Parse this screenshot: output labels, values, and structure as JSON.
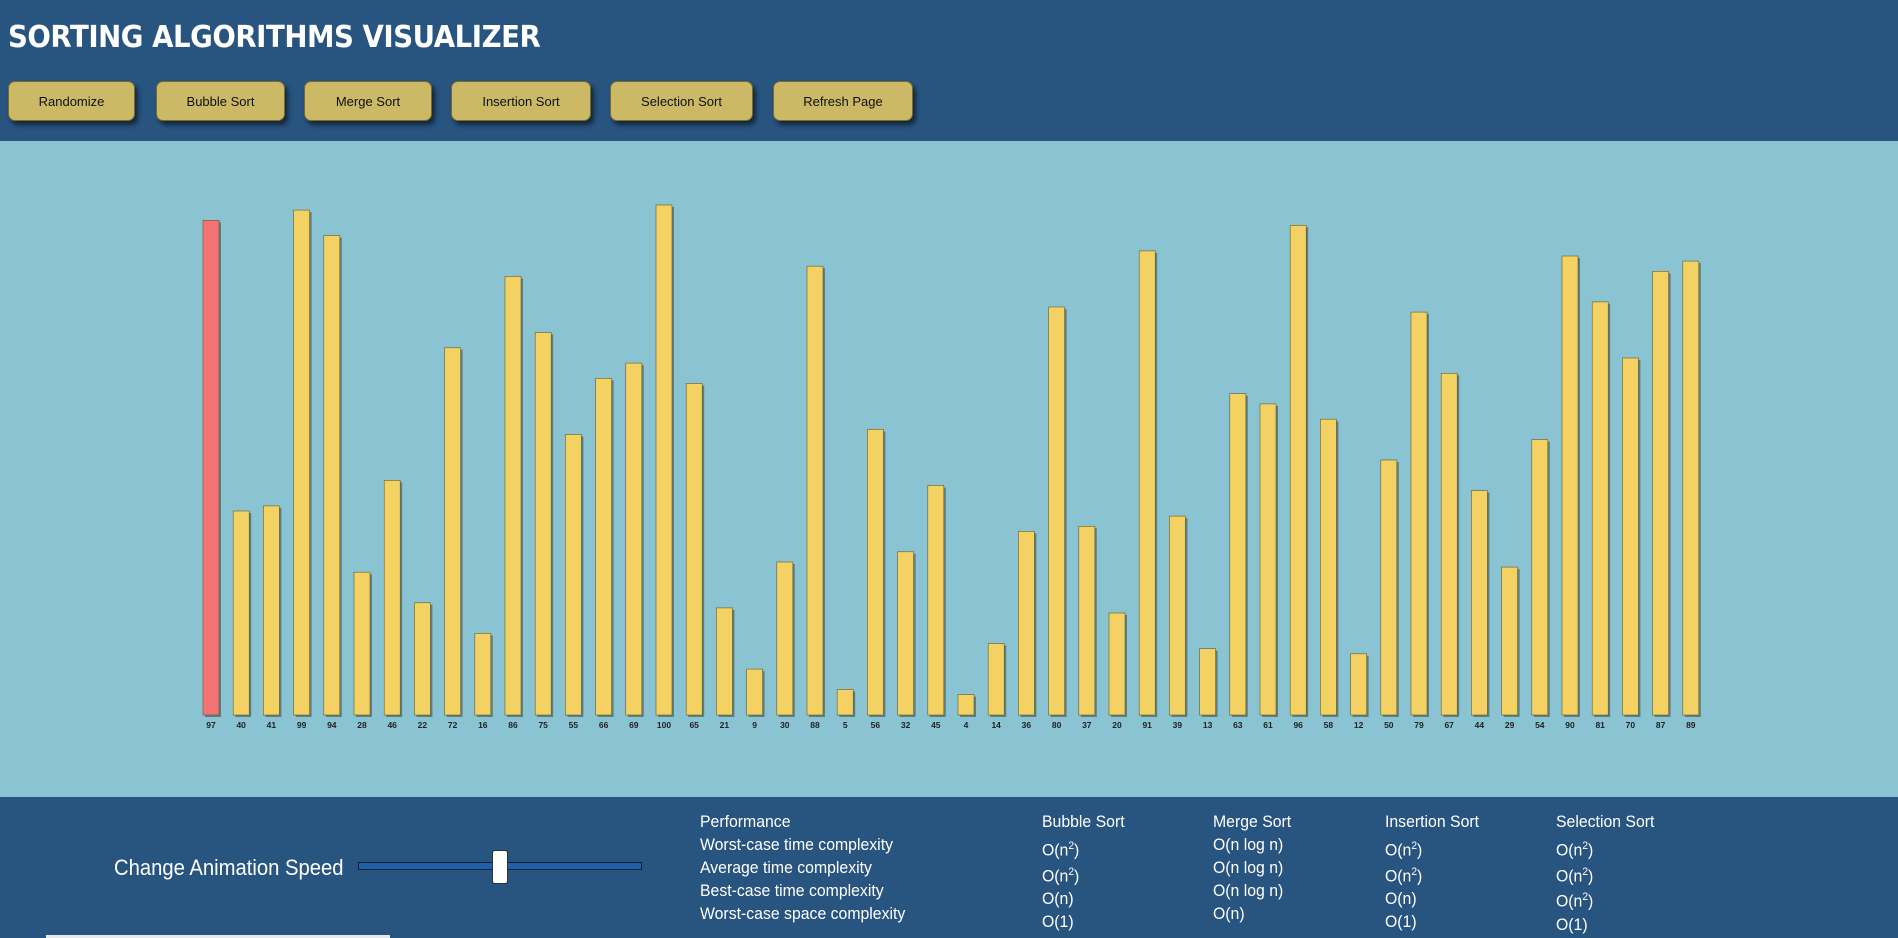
{
  "header": {
    "title": "SORTING ALGORITHMS VISUALIZER",
    "buttons": [
      "Randomize",
      "Bubble Sort",
      "Merge Sort",
      "Insertion Sort",
      "Selection Sort",
      "Refresh Page"
    ]
  },
  "colors": {
    "header_bg": "#285480",
    "chart_bg": "#8ac4d2",
    "bar": "#f3d163",
    "bar_active": "#f47474",
    "button": "#ccb966"
  },
  "chart_data": {
    "type": "bar",
    "values": [
      97,
      40,
      41,
      99,
      94,
      28,
      46,
      22,
      72,
      16,
      86,
      75,
      55,
      66,
      69,
      100,
      65,
      21,
      9,
      30,
      88,
      5,
      56,
      32,
      45,
      4,
      14,
      36,
      80,
      37,
      20,
      91,
      39,
      13,
      63,
      61,
      96,
      58,
      12,
      50,
      79,
      67,
      44,
      29,
      54,
      90,
      81,
      70,
      87,
      89
    ],
    "categories": [
      "97",
      "40",
      "41",
      "99",
      "94",
      "28",
      "46",
      "22",
      "72",
      "16",
      "86",
      "75",
      "55",
      "66",
      "69",
      "100",
      "65",
      "21",
      "9",
      "30",
      "88",
      "5",
      "56",
      "32",
      "45",
      "4",
      "14",
      "36",
      "80",
      "37",
      "20",
      "91",
      "39",
      "13",
      "63",
      "61",
      "96",
      "58",
      "12",
      "50",
      "79",
      "67",
      "44",
      "29",
      "54",
      "90",
      "81",
      "70",
      "87",
      "89"
    ],
    "highlighted_index": 0,
    "ylim": [
      0,
      100
    ],
    "grid": false
  },
  "footer": {
    "speed_label": "Change Animation Speed",
    "speed_value": 0.5,
    "performance": {
      "row_labels": [
        "Performance",
        "Worst-case time complexity",
        "Average time complexity",
        "Best-case time complexity",
        "Worst-case space complexity"
      ],
      "columns": [
        {
          "name": "Bubble Sort",
          "worst": "O(n^2)",
          "average": "O(n^2)",
          "best": "O(n)",
          "space": "O(1)"
        },
        {
          "name": "Merge Sort",
          "worst": "O(n log n)",
          "average": "O(n log n)",
          "best": "O(n log n)",
          "space": "O(n)"
        },
        {
          "name": "Insertion Sort",
          "worst": "O(n^2)",
          "average": "O(n^2)",
          "best": "O(n)",
          "space": "O(1)"
        },
        {
          "name": "Selection Sort",
          "worst": "O(n^2)",
          "average": "O(n^2)",
          "best": "O(n^2)",
          "space": "O(1)"
        }
      ]
    }
  }
}
